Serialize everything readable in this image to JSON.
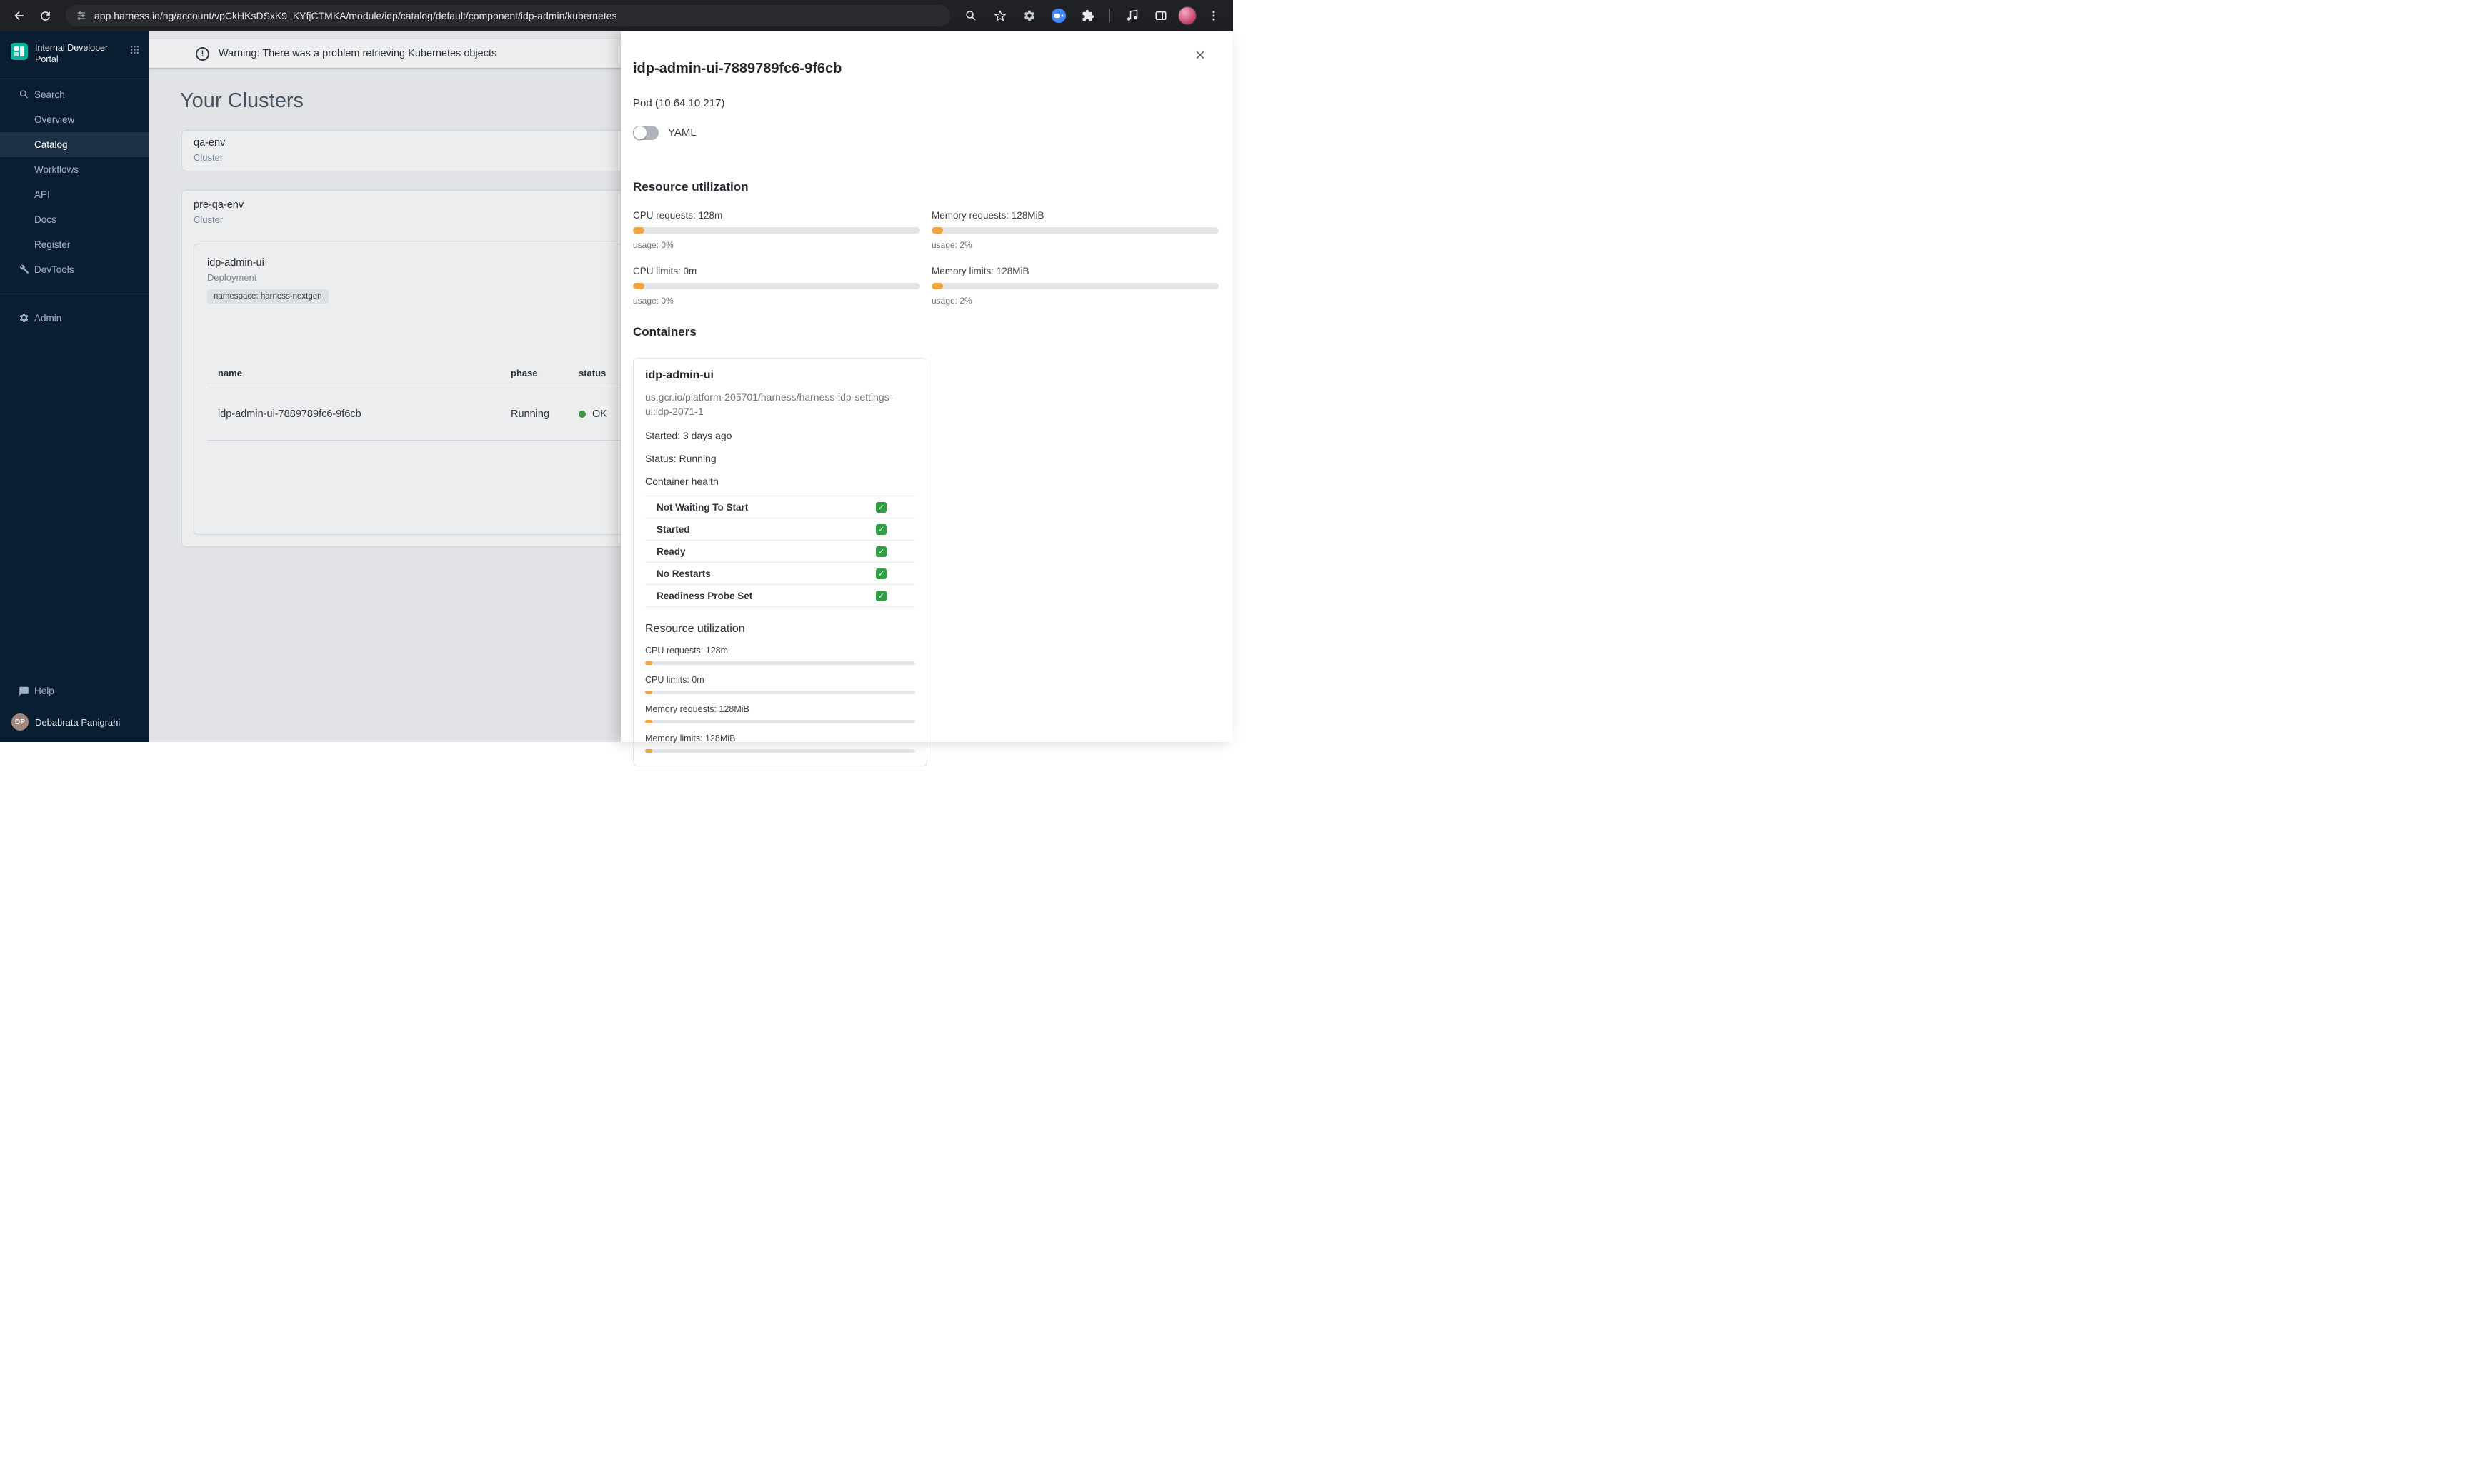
{
  "browser": {
    "url": "app.harness.io/ng/account/vpCkHKsDSxK9_KYfjCTMKA/module/idp/catalog/default/component/idp-admin/kubernetes"
  },
  "sidebar": {
    "logo_title": "Internal Developer Portal",
    "items": [
      {
        "label": "Search"
      },
      {
        "label": "Overview"
      },
      {
        "label": "Catalog"
      },
      {
        "label": "Workflows"
      },
      {
        "label": "API"
      },
      {
        "label": "Docs"
      },
      {
        "label": "Register"
      },
      {
        "label": "DevTools"
      },
      {
        "label": "Admin"
      }
    ],
    "help_label": "Help",
    "user": {
      "initials": "DP",
      "name": "Debabrata Panigrahi"
    }
  },
  "main": {
    "warning": "Warning: There was a problem retrieving Kubernetes objects",
    "title": "Your Clusters",
    "clusters": [
      {
        "name": "qa-env",
        "type": "Cluster"
      },
      {
        "name": "pre-qa-env",
        "type": "Cluster"
      }
    ],
    "deployment": {
      "name": "idp-admin-ui",
      "type": "Deployment",
      "namespace_chip": "namespace: harness-nextgen",
      "table": {
        "columns": [
          "name",
          "phase",
          "status"
        ],
        "rows": [
          {
            "name": "idp-admin-ui-7889789fc6-9f6cb",
            "phase": "Running",
            "status": "OK"
          }
        ]
      }
    }
  },
  "drawer": {
    "title": "idp-admin-ui-7889789fc6-9f6cb",
    "subtitle": "Pod (10.64.10.217)",
    "yaml_toggle_label": "YAML",
    "resource_utilization": {
      "heading": "Resource utilization",
      "metrics": [
        {
          "label": "CPU requests: 128m",
          "usage": "usage: 0%"
        },
        {
          "label": "Memory requests: 128MiB",
          "usage": "usage: 2%"
        },
        {
          "label": "CPU limits: 0m",
          "usage": "usage: 0%"
        },
        {
          "label": "Memory limits: 128MiB",
          "usage": "usage: 2%"
        }
      ]
    },
    "containers": {
      "heading": "Containers",
      "card": {
        "name": "idp-admin-ui",
        "image": "us.gcr.io/platform-205701/harness/harness-idp-settings-ui:idp-2071-1",
        "started": "Started: 3 days ago",
        "status": "Status: Running",
        "health_heading": "Container health",
        "health_checks": [
          "Not Waiting To Start",
          "Started",
          "Ready",
          "No Restarts",
          "Readiness Probe Set"
        ],
        "resource_heading": "Resource utilization",
        "metrics": [
          {
            "label": "CPU requests: 128m"
          },
          {
            "label": "CPU limits: 0m"
          },
          {
            "label": "Memory requests: 128MiB"
          },
          {
            "label": "Memory limits: 128MiB"
          }
        ]
      }
    }
  },
  "colors": {
    "accent_orange": "#F2A33C",
    "status_green": "#43A047",
    "check_green": "#2F9E44",
    "sidebar_bg": "#0A1E33",
    "chrome_bg": "#1F2125"
  }
}
